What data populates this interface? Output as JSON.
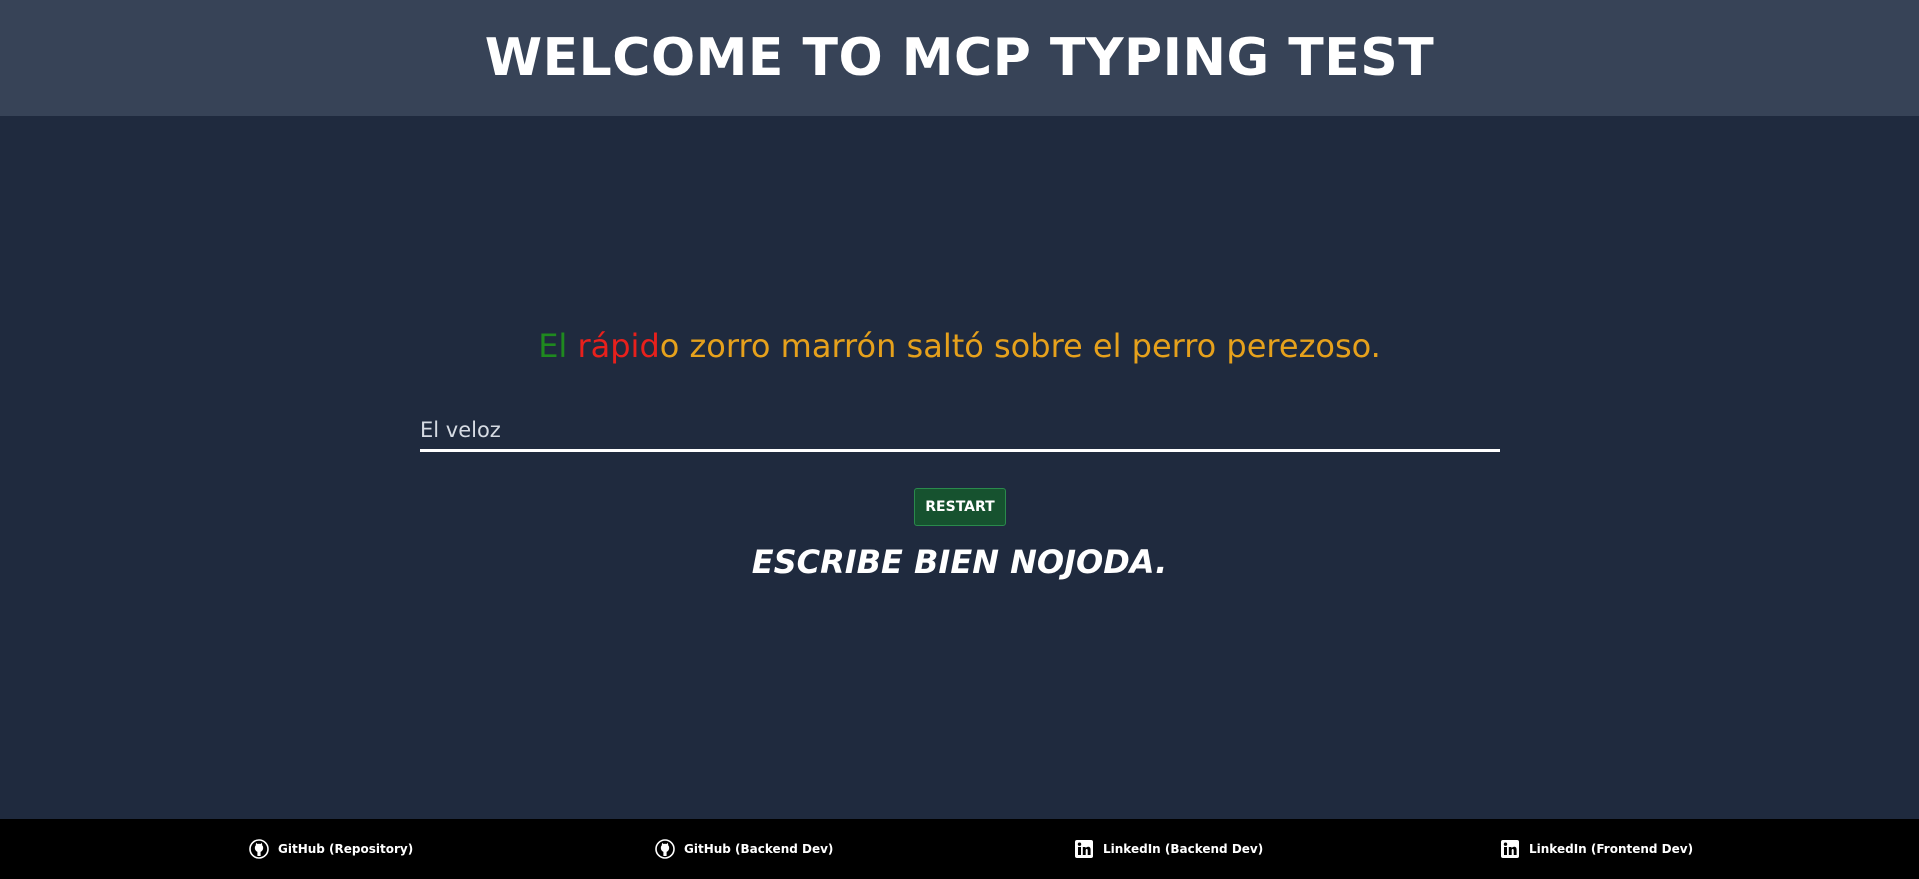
{
  "header": {
    "title": "WELCOME TO MCP TYPING TEST"
  },
  "sentence": {
    "correct": "El ",
    "wrong": "rápid",
    "pending": "o zorro marrón saltó sobre el perro perezoso."
  },
  "typing": {
    "value": "El veloz"
  },
  "restart": {
    "label": "RESTART"
  },
  "message": "ESCRIBE BIEN NOJODA.",
  "colors": {
    "correct": "#1f8a1f",
    "wrong": "#e8201c",
    "pending": "#e6a11c",
    "restart_bg": "#16522f"
  },
  "footer": {
    "links": [
      {
        "label": "GitHub (Repository)",
        "icon": "github-icon"
      },
      {
        "label": "GitHub (Backend Dev)",
        "icon": "github-icon"
      },
      {
        "label": "LinkedIn (Backend Dev)",
        "icon": "linkedin-icon"
      },
      {
        "label": "LinkedIn (Frontend Dev)",
        "icon": "linkedin-icon"
      }
    ]
  }
}
